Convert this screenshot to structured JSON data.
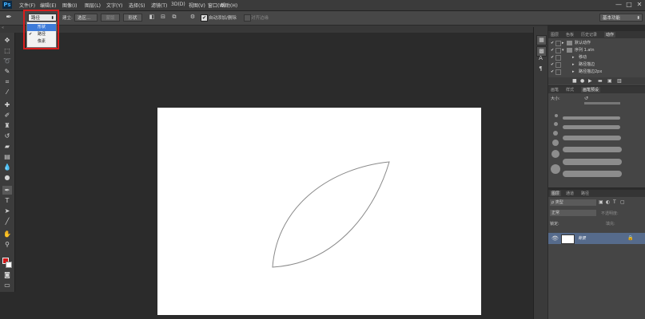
{
  "app": {
    "logo": "Ps"
  },
  "menu": [
    "文件(F)",
    "编辑(E)",
    "图像(I)",
    "图层(L)",
    "文字(Y)",
    "选择(S)",
    "滤镜(T)",
    "3D(D)",
    "视图(V)",
    "窗口(W)",
    "帮助(H)"
  ],
  "window_controls": {
    "minimize": "—",
    "maximize": "□",
    "close": "✕"
  },
  "options": {
    "mode_value": "路径",
    "build_label": "建立:",
    "select_btn": "选区...",
    "mask_btn": "蒙版",
    "shape_btn": "形状",
    "auto_add_delete": "自动添加/删除",
    "align_edges": "对齐边缘",
    "workspace": "基本功能"
  },
  "mode_dropdown": {
    "items": [
      {
        "label": "形状",
        "checked": false
      },
      {
        "label": "路径",
        "checked": true
      },
      {
        "label": "像素",
        "checked": false
      }
    ],
    "checkmark": "✔"
  },
  "panels": {
    "actions": {
      "tabs": [
        "图层",
        "色板",
        "历史记录",
        "动作"
      ],
      "rows": [
        {
          "label": "默认动作",
          "indent": 1
        },
        {
          "label": "序列 1.atn",
          "indent": 1
        },
        {
          "label": "移动",
          "indent": 2
        },
        {
          "label": "路径描边",
          "indent": 2
        },
        {
          "label": "路径描边2px",
          "indent": 2
        }
      ]
    },
    "brush": {
      "tabs": [
        "画笔",
        "样式",
        "画笔预设"
      ],
      "size_label": "大小:"
    },
    "layers": {
      "tabs": [
        "图层",
        "通道",
        "路径"
      ],
      "kind_label": "ρ 类型",
      "blend_mode": "正常",
      "opacity_label": "不透明度:",
      "lock_label": "锁定:",
      "fill_label": "填充:",
      "layer_name": "背景"
    }
  },
  "colors": {
    "highlight": "#d91e1e",
    "foreground": "#d01717",
    "background": "#ffffff",
    "selected_layer": "#566b8c"
  }
}
